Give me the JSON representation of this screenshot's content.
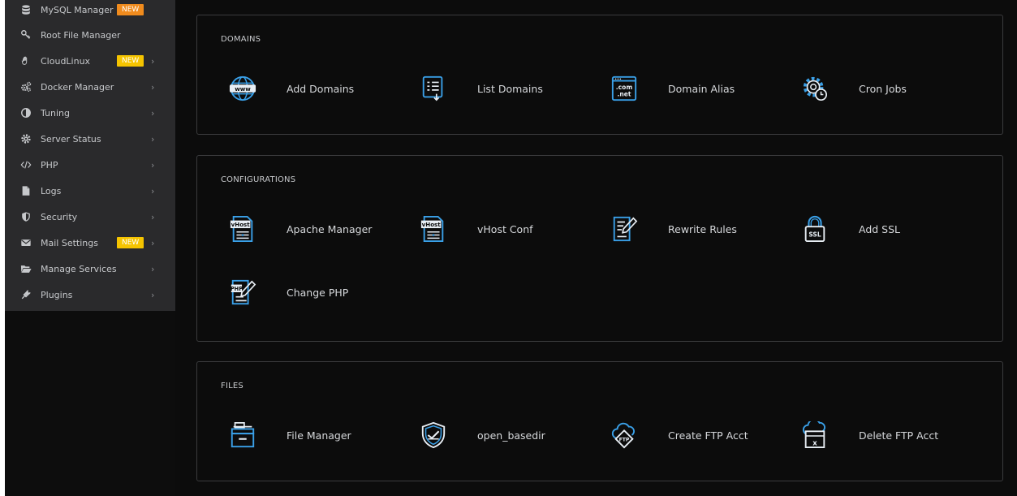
{
  "sidebar": {
    "items": [
      {
        "label": "MySQL Manager",
        "icon": "database-icon",
        "badge": "NEW",
        "badge_color": "#f08b1d",
        "chevron": false
      },
      {
        "label": "Root File Manager",
        "icon": "key-icon",
        "badge": null,
        "chevron": false
      },
      {
        "label": "CloudLinux",
        "icon": "hand-icon",
        "badge": "NEW",
        "badge_color": "#f5c400",
        "chevron": true
      },
      {
        "label": "Docker Manager",
        "icon": "gears-icon",
        "badge": null,
        "chevron": true
      },
      {
        "label": "Tuning",
        "icon": "contrast-icon",
        "badge": null,
        "chevron": true
      },
      {
        "label": "Server Status",
        "icon": "gear-icon",
        "badge": null,
        "chevron": true
      },
      {
        "label": "PHP",
        "icon": "code-icon",
        "badge": null,
        "chevron": true
      },
      {
        "label": "Logs",
        "icon": "file-icon",
        "badge": null,
        "chevron": true
      },
      {
        "label": "Security",
        "icon": "shield-icon",
        "badge": null,
        "chevron": true
      },
      {
        "label": "Mail Settings",
        "icon": "envelope-icon",
        "badge": "NEW",
        "badge_color": "#f5c400",
        "chevron": true
      },
      {
        "label": "Manage Services",
        "icon": "folder-open-icon",
        "badge": null,
        "chevron": true
      },
      {
        "label": "Plugins",
        "icon": "plug-icon",
        "badge": null,
        "chevron": true
      }
    ],
    "chevron_glyph": "›"
  },
  "sections": {
    "domains": {
      "title": "DOMAINS",
      "tiles": [
        {
          "label": "Add Domains",
          "icon": "www-globe-icon"
        },
        {
          "label": "List Domains",
          "icon": "list-document-icon"
        },
        {
          "label": "Domain Alias",
          "icon": "com-net-icon"
        },
        {
          "label": "Cron Jobs",
          "icon": "gear-clock-icon"
        }
      ]
    },
    "configurations": {
      "title": "CONFIGURATIONS",
      "tiles": [
        {
          "label": "Apache Manager",
          "icon": "vhost-file-icon"
        },
        {
          "label": "vHost Conf",
          "icon": "vhost-file-icon"
        },
        {
          "label": "Rewrite Rules",
          "icon": "edit-document-icon"
        },
        {
          "label": "Add SSL",
          "icon": "ssl-lock-icon"
        },
        {
          "label": "Change PHP",
          "icon": "php-file-edit-icon"
        }
      ]
    },
    "files": {
      "title": "FILES",
      "tiles": [
        {
          "label": "File Manager",
          "icon": "file-cabinet-icon"
        },
        {
          "label": "open_basedir",
          "icon": "shield-check-icon"
        },
        {
          "label": "Create FTP Acct",
          "icon": "ftp-cloud-icon"
        },
        {
          "label": "Delete FTP Acct",
          "icon": "ftp-delete-icon"
        }
      ]
    }
  },
  "colors": {
    "sidebar_bg": "#2a2a2c",
    "main_bg": "#0c0c0c",
    "card_border": "#3a3b3d",
    "icon_blue": "#3aa0e8",
    "icon_white": "#e8eef4"
  }
}
